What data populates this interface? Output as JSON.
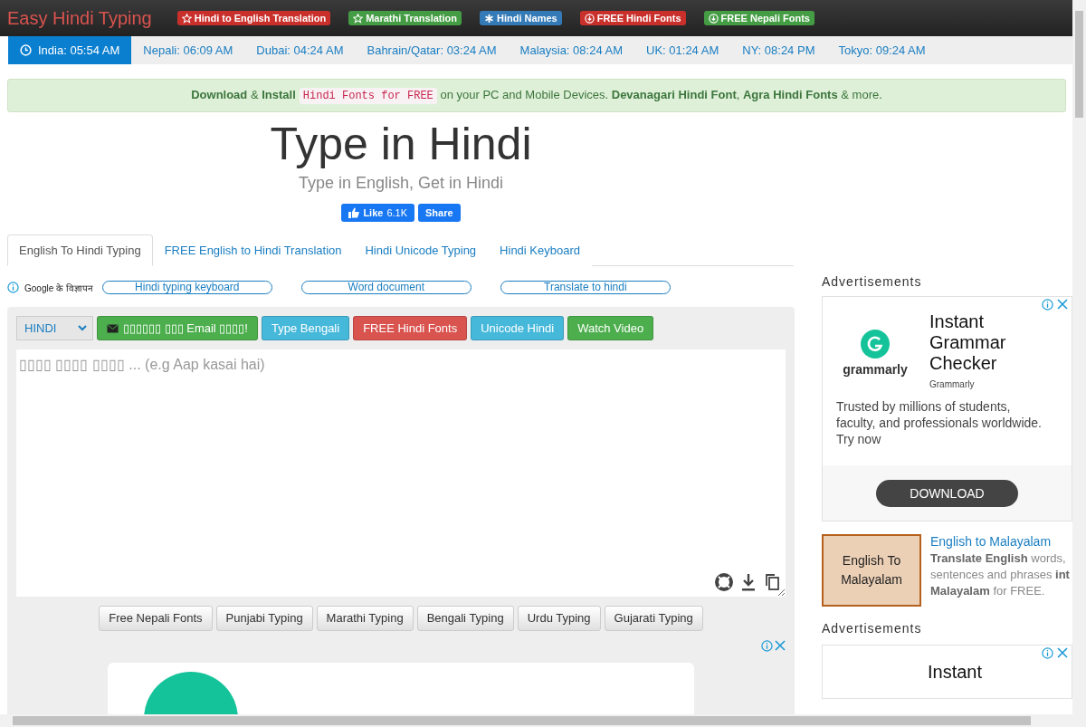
{
  "header": {
    "brand": "Easy Hindi Typing",
    "links": [
      {
        "label": "Hindi to English Translation",
        "color": "#c9302c",
        "kind": "star"
      },
      {
        "label": "Marathi Translation",
        "color": "#449d44",
        "kind": "star"
      },
      {
        "label": "Hindi Names",
        "color": "#337ab7",
        "kind": "asterisk"
      },
      {
        "label": "FREE Hindi Fonts",
        "color": "#c9302c",
        "kind": "download"
      },
      {
        "label": "FREE Nepali Fonts",
        "color": "#449d44",
        "kind": "download"
      }
    ]
  },
  "clocks": [
    {
      "label": "India: 05:54 AM",
      "selected": true
    },
    {
      "label": "Nepali: 06:09 AM",
      "selected": false
    },
    {
      "label": "Dubai: 04:24 AM",
      "selected": false
    },
    {
      "label": "Bahrain/Qatar: 03:24 AM",
      "selected": false
    },
    {
      "label": "Malaysia: 08:24 AM",
      "selected": false
    },
    {
      "label": "UK: 01:24 AM",
      "selected": false
    },
    {
      "label": "NY: 08:24 PM",
      "selected": false
    },
    {
      "label": "Tokyo: 09:24 AM",
      "selected": false
    }
  ],
  "notice": [
    {
      "kind": "bold",
      "text": "Download"
    },
    {
      "kind": "plain",
      "text": " & "
    },
    {
      "kind": "bold",
      "text": "Install"
    },
    {
      "kind": "code",
      "text": "Hindi Fonts for FREE"
    },
    {
      "kind": "plain",
      "text": " on your PC and Mobile Devices. "
    },
    {
      "kind": "bold",
      "text": "Devanagari Hindi Font"
    },
    {
      "kind": "plain",
      "text": ", "
    },
    {
      "kind": "bold",
      "text": "Agra Hindi Fonts"
    },
    {
      "kind": "plain",
      "text": " & more."
    }
  ],
  "title": "Type in Hindi",
  "subtitle": "Type in English, Get in Hindi",
  "social": {
    "like": "Like",
    "count": "6.1K",
    "share": "Share"
  },
  "tabs": [
    {
      "label": "English To Hindi Typing",
      "selected": true
    },
    {
      "label": "FREE English to Hindi Translation",
      "selected": false
    },
    {
      "label": "Hindi Unicode Typing",
      "selected": false
    },
    {
      "label": "Hindi Keyboard",
      "selected": false
    }
  ],
  "ad_links": {
    "label": "Google के विज्ञापन",
    "links": [
      "Hindi typing keyboard",
      "Word document",
      "Translate to hindi"
    ]
  },
  "toolbar": {
    "language": "HINDI",
    "buttons": [
      {
        "label": "▯▯▯▯▯▯ ▯▯▯ Email ▯▯▯▯!",
        "color": "#4cae4c",
        "kind": "mail"
      },
      {
        "label": "Type Bengali",
        "color": "#46b8da",
        "kind": "plain"
      },
      {
        "label": "FREE Hindi Fonts",
        "color": "#d9534f",
        "kind": "plain"
      },
      {
        "label": "Unicode Hindi",
        "color": "#46b8da",
        "kind": "plain"
      },
      {
        "label": "Watch Video",
        "color": "#4cae4c",
        "kind": "plain"
      }
    ]
  },
  "editor": {
    "placeholder": "▯▯▯▯ ▯▯▯▯ ▯▯▯▯ ... (e.g Aap kasai hai)"
  },
  "language_buttons": [
    "Free Nepali Fonts",
    "Punjabi Typing",
    "Marathi Typing",
    "Bengali Typing",
    "Urdu Typing",
    "Gujarati Typing"
  ],
  "sidebar": {
    "heading": "Advertisements",
    "ad": {
      "logo": "grammarly",
      "title": "Instant Grammar Checker",
      "advertiser": "Grammarly",
      "body": "Trusted by millions of students, faculty, and professionals worldwide. Try now",
      "cta": "DOWNLOAD"
    },
    "promo": {
      "box": "English To Malayalam",
      "link": "English to Malayalam",
      "lines": [
        "**Translate English** words,",
        "sentences and phrases **int**",
        "**Malayalam** for FREE."
      ]
    },
    "heading_2": "Advertisements",
    "ad_2": {
      "title": "Instant"
    }
  }
}
